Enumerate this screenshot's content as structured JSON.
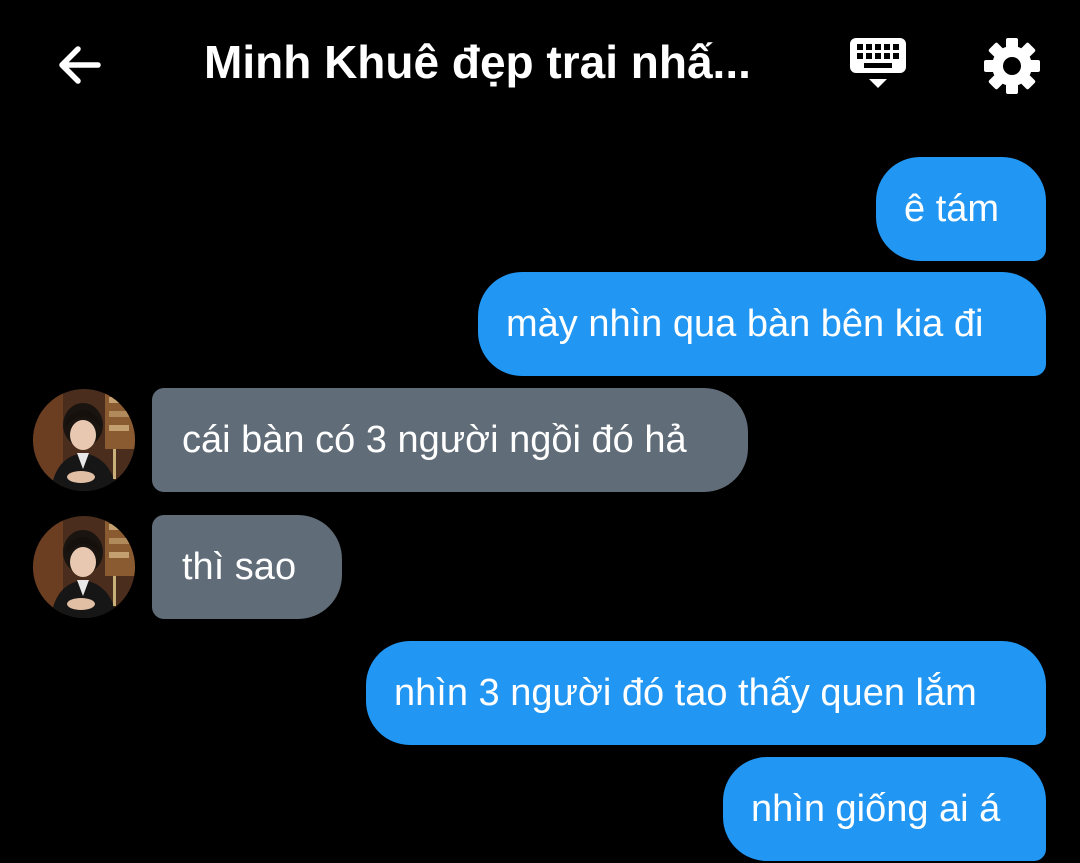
{
  "header": {
    "title": "Minh Khuê đẹp trai nhấ...",
    "back_icon": "arrow-left-icon",
    "keyboard_icon": "keyboard-icon",
    "settings_icon": "gear-icon"
  },
  "colors": {
    "background": "#000000",
    "sent_bubble": "#2196f3",
    "received_bubble": "#606c78",
    "text": "#ffffff"
  },
  "messages": [
    {
      "direction": "sent",
      "text": "ê tám"
    },
    {
      "direction": "sent",
      "text": "mày nhìn qua bàn bên kia đi"
    },
    {
      "direction": "received",
      "text": "cái bàn có 3 người ngồi đó hả"
    },
    {
      "direction": "received",
      "text": "thì sao"
    },
    {
      "direction": "sent",
      "text": "nhìn 3 người đó tao thấy quen lắm"
    },
    {
      "direction": "sent",
      "text": "nhìn giống ai á"
    }
  ]
}
